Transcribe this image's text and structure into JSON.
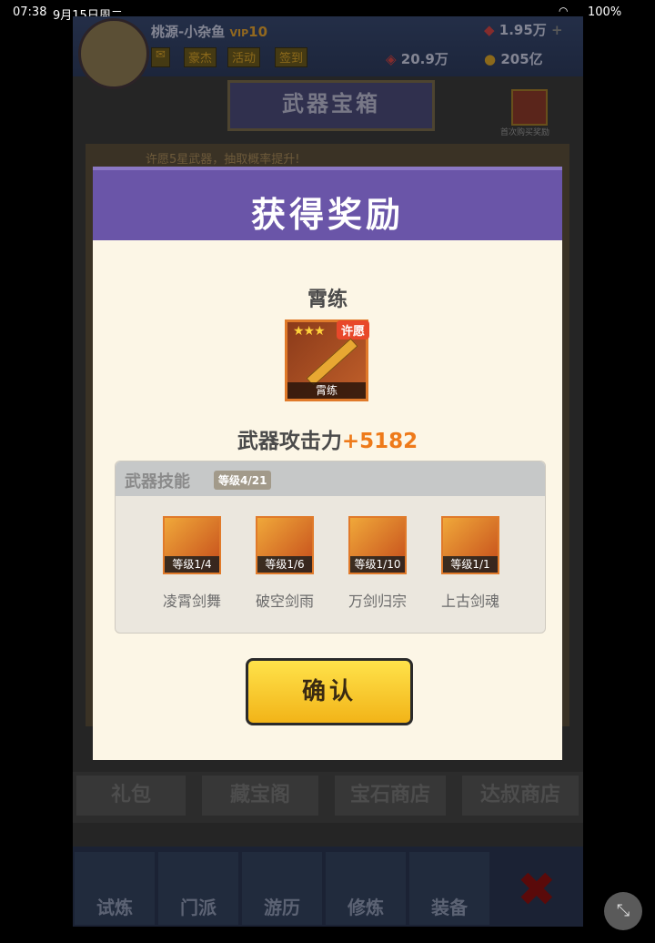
{
  "status_bar": {
    "time": "07:38",
    "date": "9月15日周二",
    "battery": "100%"
  },
  "header": {
    "player_name": "桃源-小杂鱼",
    "vip": "10",
    "tag": "豪杰",
    "activity": "活动",
    "signin": "签到",
    "gem_amount": "1.95万",
    "power": "20.9万",
    "gold": "205亿",
    "page_title": "武器宝箱",
    "first_purchase": "首次购买奖励",
    "hint": "许愿5星武器，抽取概率提升!"
  },
  "background_tabs": [
    "礼包",
    "藏宝阁",
    "宝石商店",
    "达叔商店"
  ],
  "bottom_nav": [
    "试炼",
    "门派",
    "游历",
    "修炼",
    "装备"
  ],
  "modal": {
    "title": "获得奖励",
    "weapon_name": "霄练",
    "weapon_caption": "霄练",
    "wish_badge": "许愿",
    "stars": "★★★",
    "attack_label": "武器攻击力",
    "attack_bonus": "+5182",
    "skills_title": "武器技能",
    "skills_level": "等级4/21",
    "skills": [
      {
        "level": "等级1/4",
        "name": "凌霄剑舞"
      },
      {
        "level": "等级1/6",
        "name": "破空剑雨"
      },
      {
        "level": "等级1/10",
        "name": "万剑归宗"
      },
      {
        "level": "等级1/1",
        "name": "上古剑魂"
      }
    ],
    "confirm": "确认"
  },
  "colors": {
    "header_purple": "#6a55a8",
    "bonus_orange": "#ee7a1a",
    "button_yellow": "#f2b418"
  }
}
